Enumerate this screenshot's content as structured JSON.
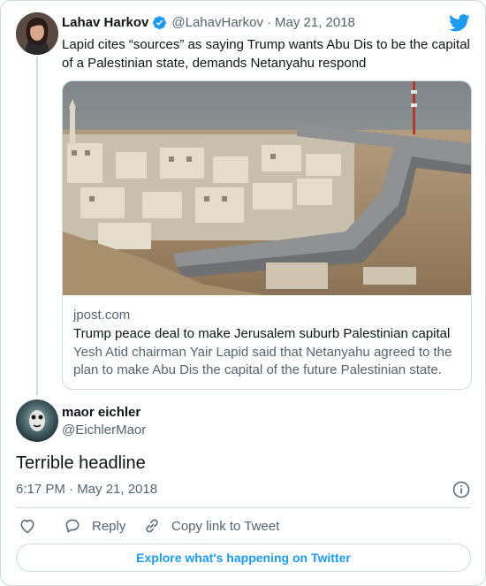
{
  "quoted_tweet": {
    "author_name": "Lahav Harkov",
    "handle": "@LahavHarkov",
    "separator": "·",
    "date": "May 21, 2018",
    "text": "Lapid cites “sources” as saying Trump wants Abu Dis to be the capital of a Palestinian state, demands Netanyahu respond",
    "verified": true,
    "link_card": {
      "domain": "jpost.com",
      "title": "Trump peace deal to make Jerusalem suburb Palestinian capital",
      "description": "Yesh Atid chairman Yair Lapid said that Netanyahu agreed to the plan to make Abu Dis the capital of the future Palestinian state."
    }
  },
  "main_tweet": {
    "author_name": "maor eichler",
    "handle": "@EichlerMaor",
    "text": "Terrible headline",
    "timestamp": "6:17 PM · May 21, 2018"
  },
  "actions": {
    "reply_label": "Reply",
    "copy_link_label": "Copy link to Tweet"
  },
  "explore_label": "Explore what's happening on Twitter",
  "colors": {
    "accent": "#1d9bf0",
    "text": "#0f1419",
    "muted": "#536471",
    "border": "#cfd9de"
  },
  "icons": [
    "twitter-bird-icon",
    "verified-badge-icon",
    "info-icon",
    "heart-icon",
    "reply-icon",
    "link-icon"
  ]
}
